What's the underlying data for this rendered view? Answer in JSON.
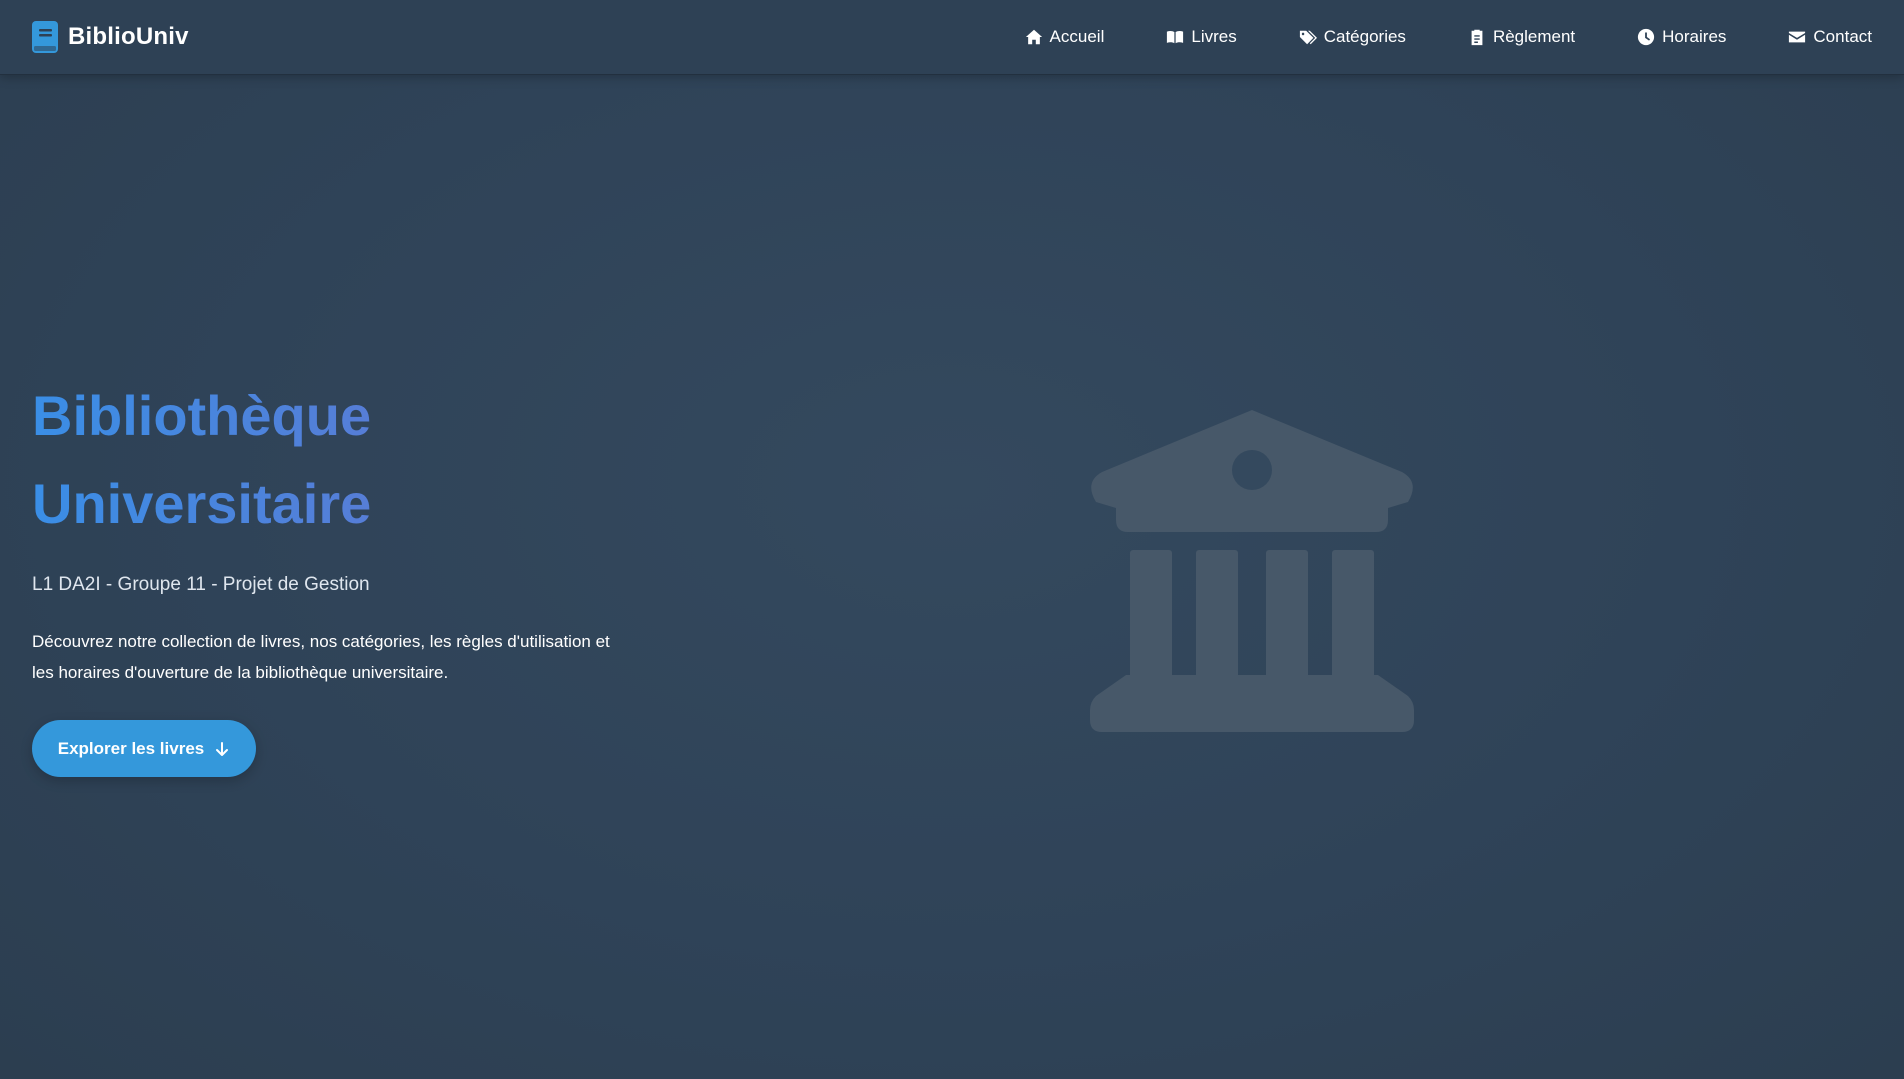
{
  "navbar": {
    "brand": "BiblioUniv",
    "brand_icon": "book-icon",
    "items": [
      {
        "label": "Accueil",
        "icon": "home-icon"
      },
      {
        "label": "Livres",
        "icon": "open-book-icon"
      },
      {
        "label": "Catégories",
        "icon": "tags-icon"
      },
      {
        "label": "Règlement",
        "icon": "clipboard-icon"
      },
      {
        "label": "Horaires",
        "icon": "clock-icon"
      },
      {
        "label": "Contact",
        "icon": "envelope-icon"
      }
    ]
  },
  "hero": {
    "title_line1": "Bibliothèque",
    "title_line2": "Universitaire",
    "subtitle": "L1 DA2I - Groupe 11 - Projet de Gestion",
    "description_line1": "Découvrez notre collection de livres, nos catégories, les règles d'utilisation et",
    "description_line2": "les horaires d'ouverture de la bibliothèque universitaire.",
    "cta_label": "Explorer les livres",
    "cta_icon": "arrow-down-icon",
    "illustration_icon": "building-columns-icon"
  },
  "colors": {
    "background": "#2f4257",
    "navbar": "#2e4155",
    "accent": "#3498db",
    "title_gradient_start": "#3a8ee6",
    "title_gradient_end": "#6f6fc9",
    "illustration": "#475869"
  }
}
